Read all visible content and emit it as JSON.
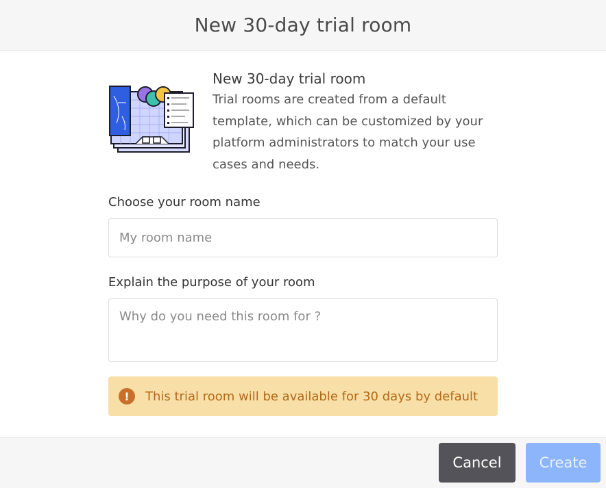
{
  "header": {
    "title": "New 30-day trial room"
  },
  "intro": {
    "heading": "New 30-day trial room",
    "description": "Trial rooms are created from a default template, which can be customized by your platform administrators to match your use cases and needs."
  },
  "form": {
    "room_name_label": "Choose your room name",
    "room_name_placeholder": "My room name",
    "room_name_value": "",
    "purpose_label": "Explain the purpose of your room",
    "purpose_placeholder": "Why do you need this room for ?",
    "purpose_value": ""
  },
  "notice": {
    "icon": "exclamation-circle-icon",
    "text": "This trial room will be available for 30 days by default",
    "color": "#b26a19",
    "background": "#f8dfa7"
  },
  "footer": {
    "cancel_label": "Cancel",
    "create_label": "Create"
  },
  "colors": {
    "cancel_button": "#535359",
    "create_button_disabled": "#8cb5fb"
  }
}
